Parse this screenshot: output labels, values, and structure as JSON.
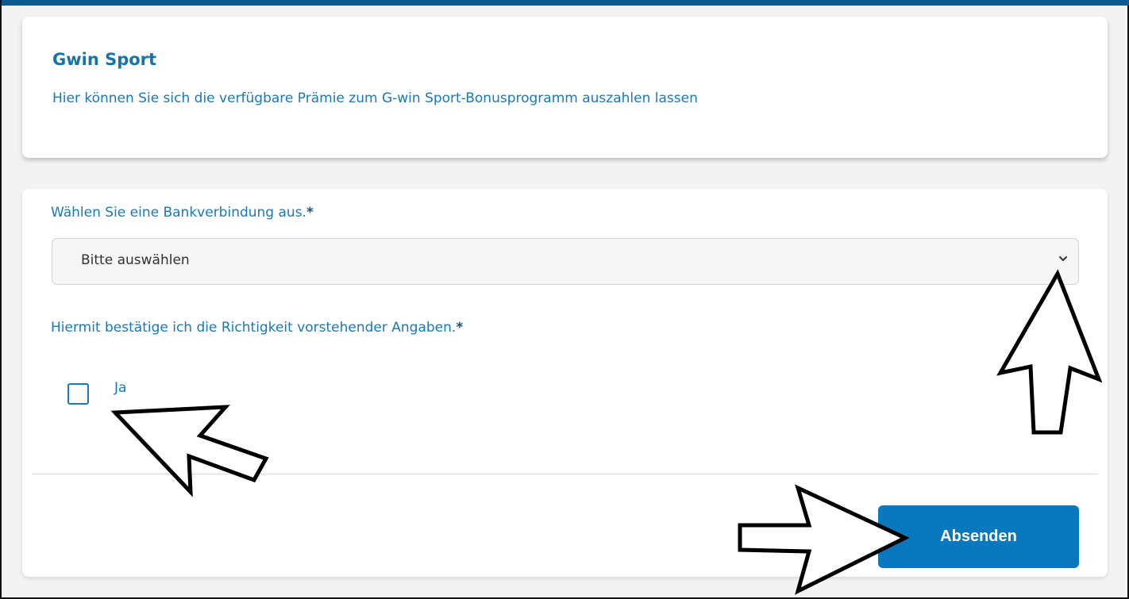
{
  "header": {
    "title": "Gwin Sport",
    "subtitle": "Hier können Sie sich die verfügbare Prämie zum G-win Sport-Bonusprogramm auszahlen lassen"
  },
  "form": {
    "bank_label": "Wählen Sie eine Bankverbindung aus.",
    "required_marker": "*",
    "bank_select_value": "Bitte auswählen",
    "confirm_label": "Hiermit bestätige ich die Richtigkeit vorstehender Angaben.",
    "checkbox_label": "Ja",
    "checkbox_checked": false,
    "submit_label": "Absenden"
  },
  "colors": {
    "topbar": "#0b5a8e",
    "accent_text": "#1b78b4",
    "button": "#0a78be"
  },
  "icons": [
    "chevron-down-icon",
    "annotation-arrow-icon"
  ]
}
